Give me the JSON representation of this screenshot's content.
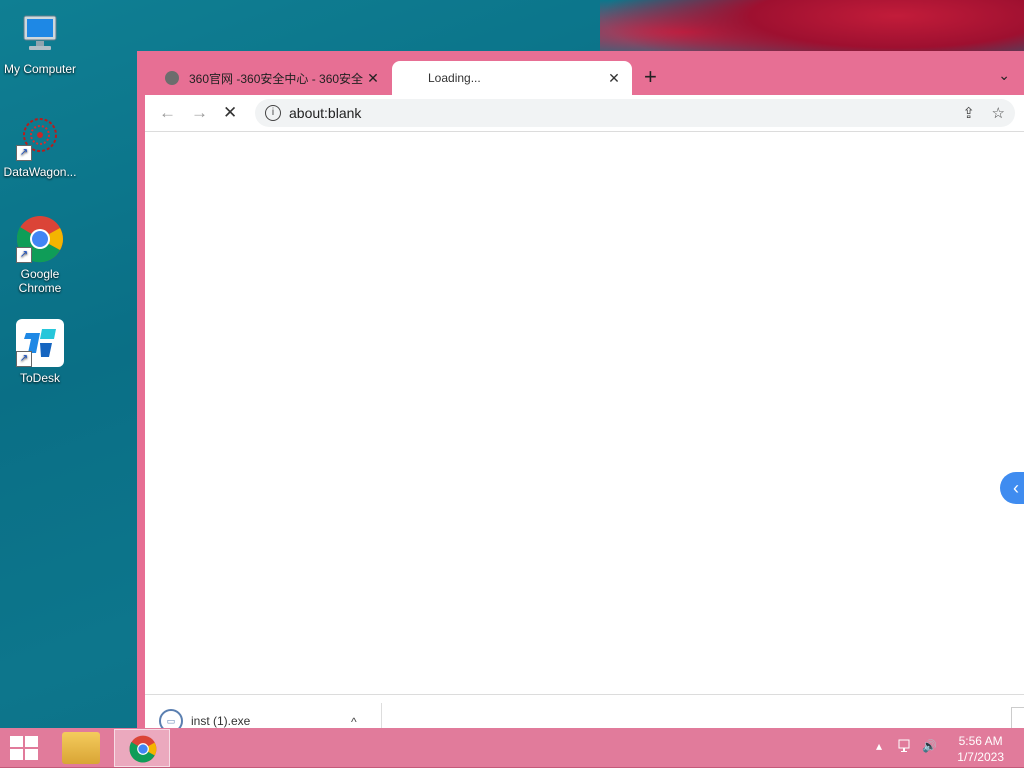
{
  "desktop": {
    "icons": [
      {
        "label": "My Computer"
      },
      {
        "label": "DataWagon..."
      },
      {
        "label": "Google Chrome"
      },
      {
        "label": "ToDesk"
      }
    ]
  },
  "browser": {
    "tabs": [
      {
        "title": "360官网 -360安全中心 - 360安全",
        "close": "✕",
        "state": "inactive"
      },
      {
        "title": "Loading...",
        "close": "✕",
        "state": "active"
      }
    ],
    "new_tab": "+",
    "tab_list": "⌄",
    "toolbar": {
      "back": "←",
      "forward": "→",
      "stop": "✕",
      "info": "i",
      "url": "about:blank",
      "share": "⇪",
      "bookmark": "☆"
    },
    "side_panel_toggle": "‹",
    "download": {
      "filename": "inst (1).exe",
      "chevron": "^"
    }
  },
  "taskbar": {
    "tray_arrow": "▴",
    "network_icon": "network-icon",
    "volume_icon": "🔊",
    "time": "5:56 AM",
    "date": "1/7/2023"
  },
  "colors": {
    "window_frame": "#e76f94",
    "taskbar": "#e17b9b",
    "desktop": "#0f7f93",
    "side_toggle": "#3f8cf0"
  }
}
